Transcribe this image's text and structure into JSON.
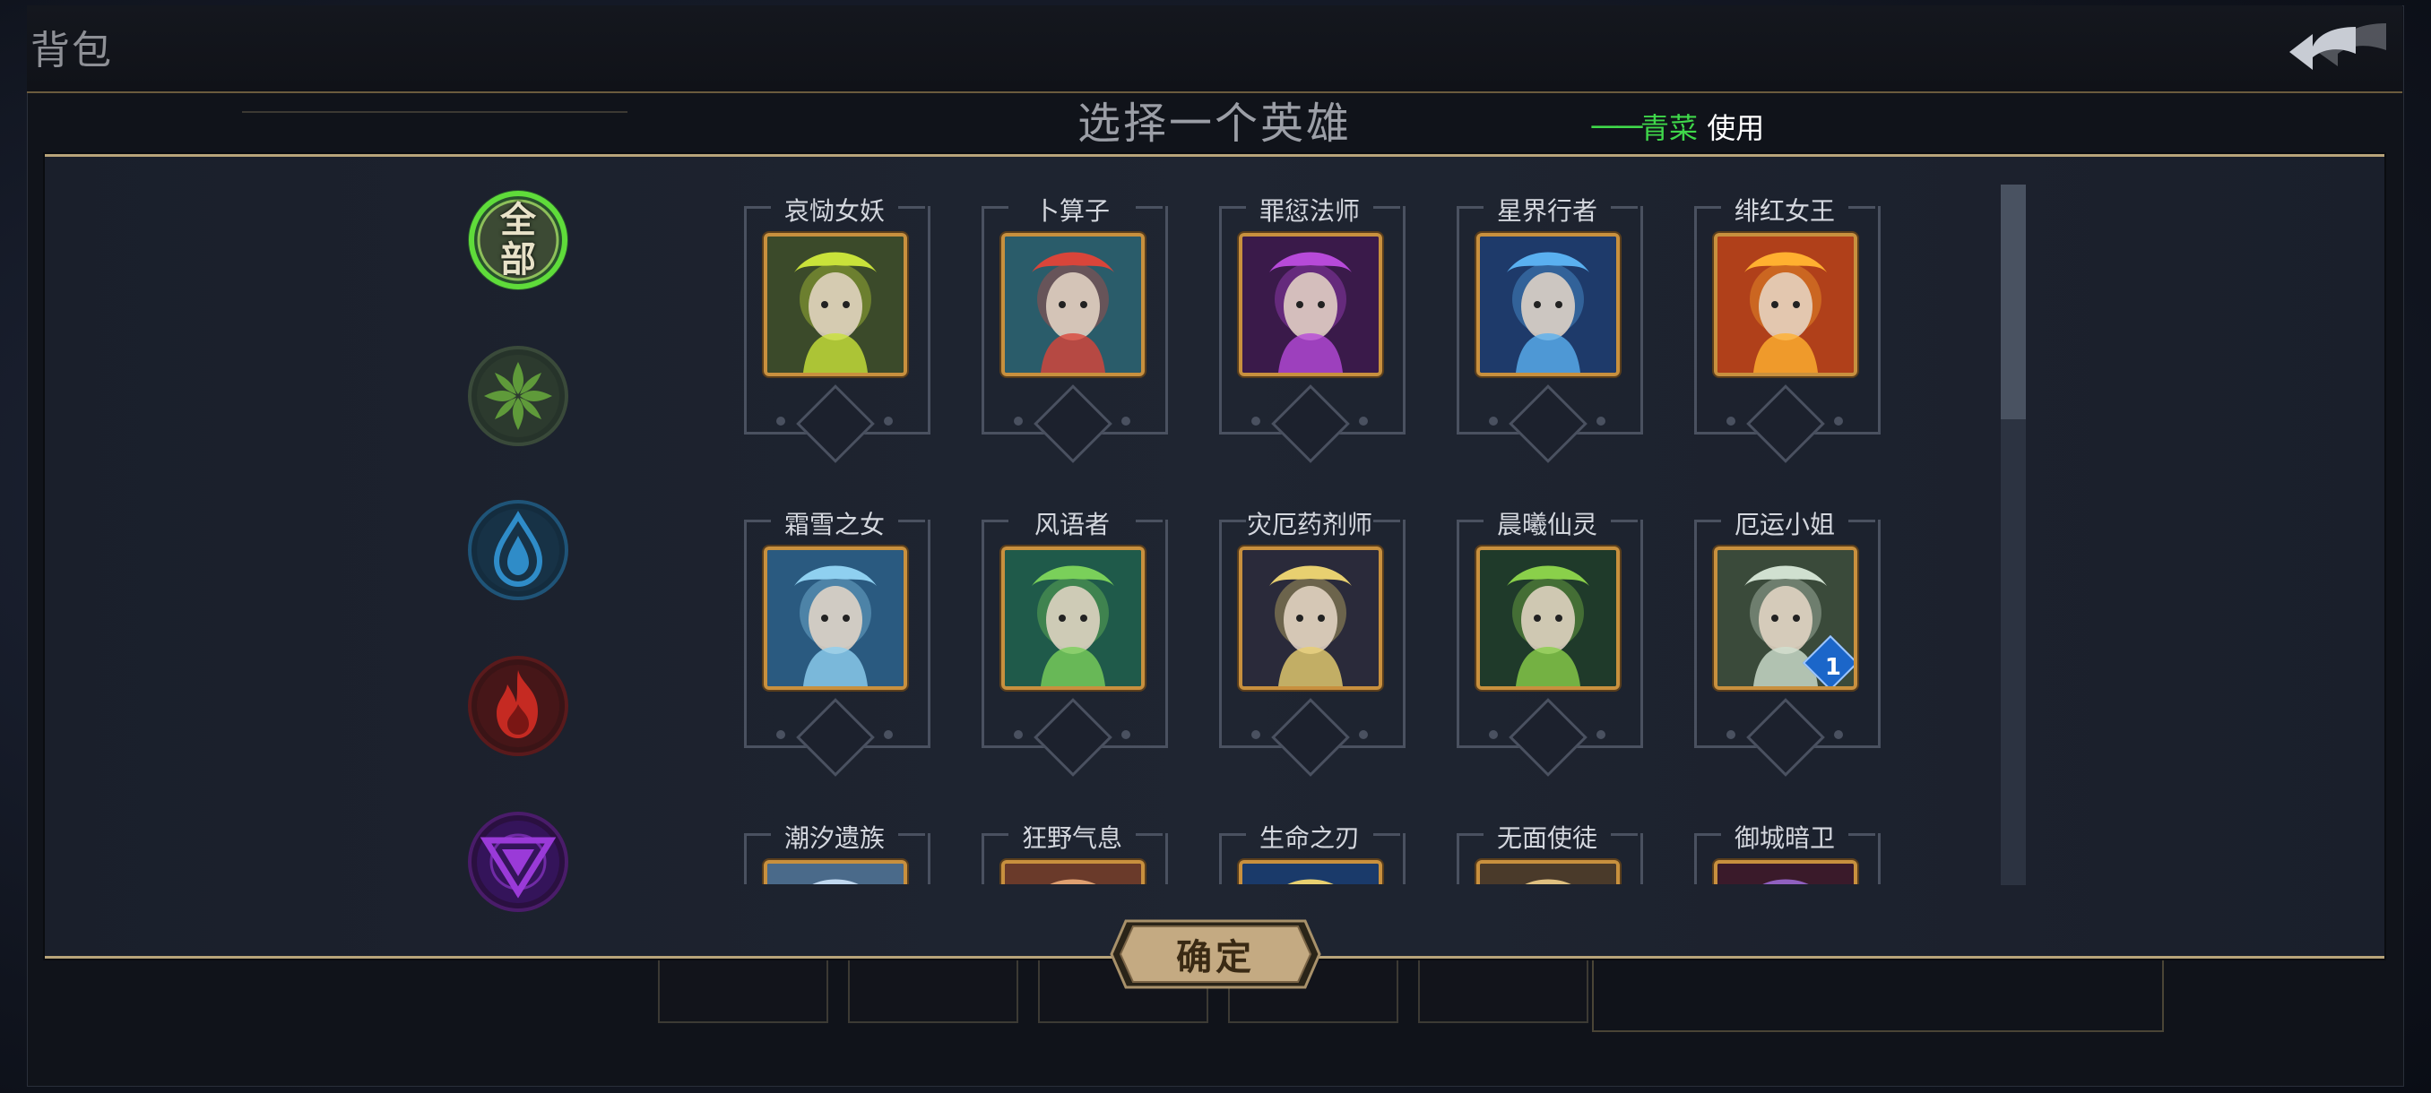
{
  "app": {
    "bag_title": "背包"
  },
  "modal": {
    "title": "选择一个英雄",
    "usage_prefix": "一一",
    "usage_item": "青菜",
    "usage_action": "使用",
    "confirm_label": "确定"
  },
  "filters": [
    {
      "id": "all",
      "label_top": "全",
      "label_bottom": "部",
      "color": "#4caf2f",
      "selected": true
    },
    {
      "id": "nature",
      "icon": "leaf-icon",
      "color": "#3d6a34"
    },
    {
      "id": "water",
      "icon": "water-drop-icon",
      "color": "#1f6d9c"
    },
    {
      "id": "fire",
      "icon": "flame-icon",
      "color": "#b0221e"
    },
    {
      "id": "arcane",
      "icon": "arcane-triangle-icon",
      "color": "#7b22b5"
    }
  ],
  "heroes": [
    {
      "name": "哀恸女妖",
      "bg": "#3b4a2a",
      "accent": "#c9e23a"
    },
    {
      "name": "卜算子",
      "bg": "#2a5c6a",
      "accent": "#d9453a"
    },
    {
      "name": "罪愆法师",
      "bg": "#3a1a4a",
      "accent": "#b74ad9"
    },
    {
      "name": "星界行者",
      "bg": "#1e3a6a",
      "accent": "#5ab0f0"
    },
    {
      "name": "绯红女王",
      "bg": "#b0401a",
      "accent": "#ffb030"
    },
    {
      "name": "霜雪之女",
      "bg": "#2a5a80",
      "accent": "#8fd0f0"
    },
    {
      "name": "风语者",
      "bg": "#1f5a4a",
      "accent": "#7ad05a"
    },
    {
      "name": "灾厄药剂师",
      "bg": "#2a2a3a",
      "accent": "#e8d070"
    },
    {
      "name": "晨曦仙灵",
      "bg": "#1f3a2a",
      "accent": "#8ad04a"
    },
    {
      "name": "厄运小姐",
      "bg": "#3a4a3a",
      "accent": "#d0e0d0",
      "level": "1"
    },
    {
      "name": "潮汐遗族",
      "bg": "#4a6a8a",
      "accent": "#c0d8f0"
    },
    {
      "name": "狂野气息",
      "bg": "#6a3a2a",
      "accent": "#e0a070"
    },
    {
      "name": "生命之刃",
      "bg": "#1a3a6a",
      "accent": "#e8d070"
    },
    {
      "name": "无面使徒",
      "bg": "#4a3a2a",
      "accent": "#e0c080"
    },
    {
      "name": "御城暗卫",
      "bg": "#3a1a2a",
      "accent": "#9060c0"
    }
  ]
}
